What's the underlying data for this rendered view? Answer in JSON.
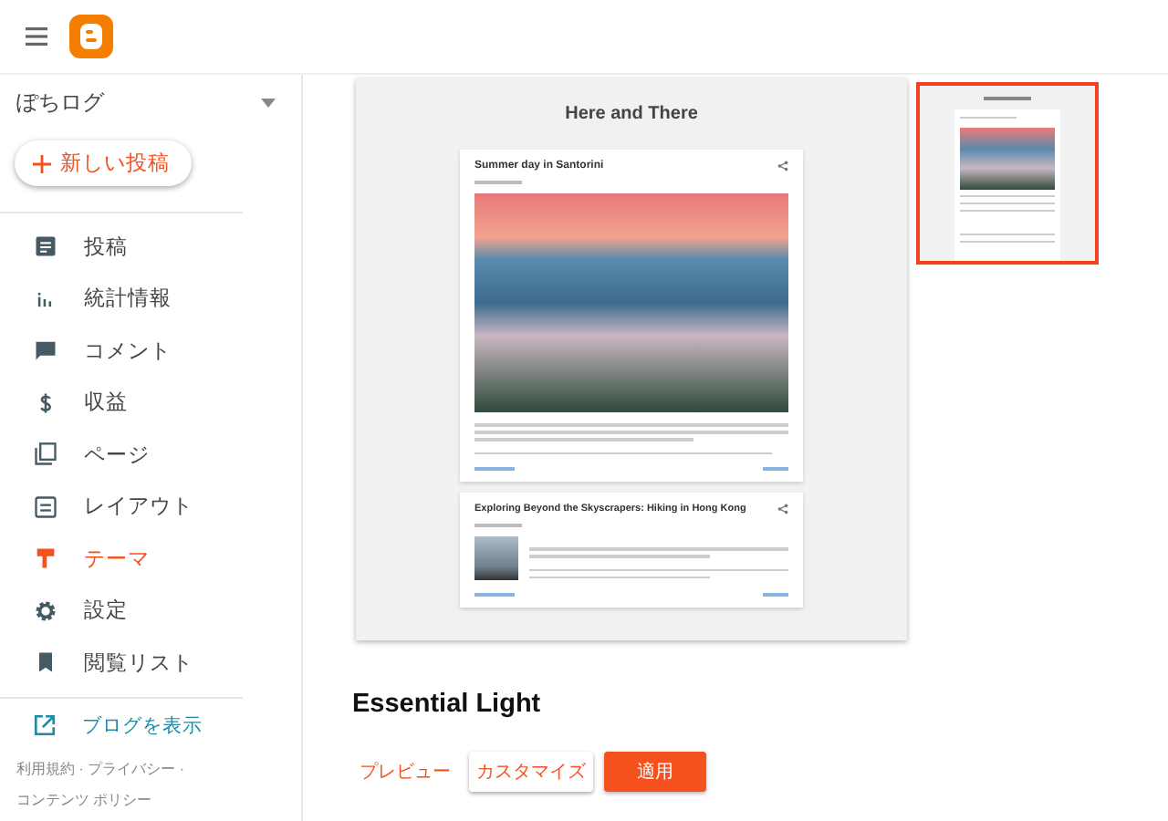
{
  "sidebar": {
    "blog_name": "ぽちログ",
    "new_post_button": "新しい投稿",
    "nav": [
      {
        "label": "投稿",
        "kind": "posts",
        "selected": false
      },
      {
        "label": "統計情報",
        "kind": "stats",
        "selected": false
      },
      {
        "label": "コメント",
        "kind": "comments",
        "selected": false
      },
      {
        "label": "収益",
        "kind": "earnings",
        "selected": false
      },
      {
        "label": "ページ",
        "kind": "pages",
        "selected": false
      },
      {
        "label": "レイアウト",
        "kind": "layout",
        "selected": false
      },
      {
        "label": "テーマ",
        "kind": "theme",
        "selected": true
      },
      {
        "label": "設定",
        "kind": "settings",
        "selected": false
      },
      {
        "label": "閲覧リスト",
        "kind": "reading",
        "selected": false
      }
    ],
    "view_blog_link": "ブログを表示",
    "footer_lines": [
      "利用規約 · プライバシー ·",
      "コンテンツ ポリシー"
    ]
  },
  "preview": {
    "blog_title": "Here and There",
    "posts": [
      {
        "title": "Summer day in Santorini",
        "kind": "hero"
      },
      {
        "title": "Exploring Beyond the Skyscrapers: Hiking in Hong Kong",
        "kind": "thumb"
      }
    ]
  },
  "thumbnails": [
    {
      "selected": true
    }
  ],
  "theme_name": "Essential Light",
  "buttons": [
    {
      "label": "プレビュー",
      "kind": "text"
    },
    {
      "label": "カスタマイズ",
      "kind": "outlined"
    },
    {
      "label": "適用",
      "kind": "filled"
    }
  ]
}
